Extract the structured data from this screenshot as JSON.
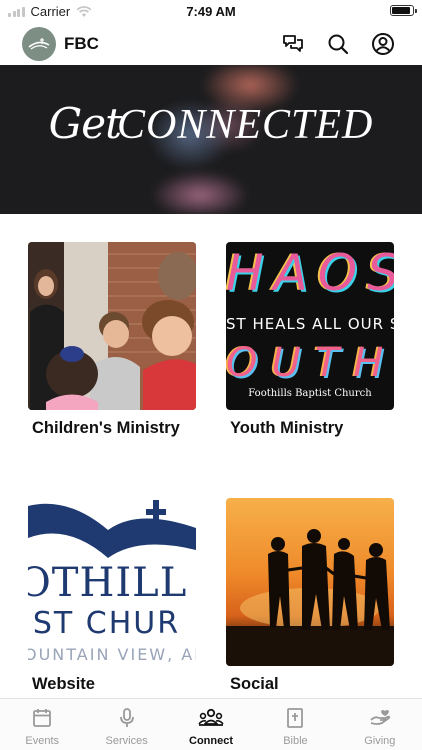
{
  "status_bar": {
    "carrier": "Carrier",
    "time": "7:49 AM",
    "battery_level": 0.95
  },
  "header": {
    "title": "FBC",
    "icons": [
      "chat-icon",
      "search-icon",
      "account-icon"
    ]
  },
  "hero": {
    "title_script": "Get",
    "title_serif": "CONNECTED"
  },
  "cards": [
    {
      "label": "Children's Ministry",
      "image": "children-ministry-photo"
    },
    {
      "label": "Youth Ministry",
      "image": "youth-chaos-graphic",
      "image_text": {
        "line1": "HAOS",
        "line2": "ST HEALS ALL OUR S",
        "line3": "OUTH",
        "caption": "Foothills Baptist Church"
      }
    },
    {
      "label": "Website",
      "image": "church-logo",
      "image_text": {
        "line1": "OTHILL",
        "line2": "IST CHUR",
        "line3": "OUNTAIN VIEW, AR"
      }
    },
    {
      "label": "Social",
      "image": "sunset-silhouettes-photo"
    }
  ],
  "tabs": [
    {
      "label": "Events",
      "icon": "calendar-icon",
      "active": false
    },
    {
      "label": "Services",
      "icon": "microphone-icon",
      "active": false
    },
    {
      "label": "Connect",
      "icon": "people-icon",
      "active": true
    },
    {
      "label": "Bible",
      "icon": "bible-icon",
      "active": false
    },
    {
      "label": "Giving",
      "icon": "giving-hand-icon",
      "active": false
    }
  ],
  "colors": {
    "active_tab": "#111111",
    "inactive_tab": "#9a9a9a",
    "logo_bg": "#7d8e85",
    "hero_bg": "#1c1c1e"
  }
}
